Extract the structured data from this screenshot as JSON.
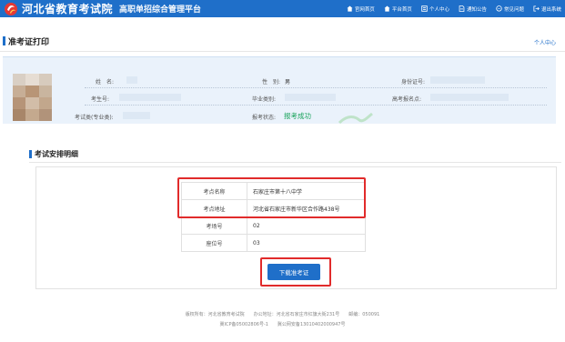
{
  "header": {
    "site_name": "河北省教育考试院",
    "platform_name": "高职单招综合管理平台",
    "nav": [
      {
        "label": "官网首页",
        "icon": "home-icon"
      },
      {
        "label": "平台首页",
        "icon": "home-icon"
      },
      {
        "label": "个人中心",
        "icon": "profile-icon"
      },
      {
        "label": "通知公告",
        "icon": "document-icon"
      },
      {
        "label": "常见问题",
        "icon": "chat-icon"
      },
      {
        "label": "退出系统",
        "icon": "logout-icon"
      }
    ]
  },
  "section_admit": {
    "title": "准考证打印",
    "personal_link": "个人中心",
    "fields": {
      "name_label": "姓　名:",
      "gender_label": "性　别:",
      "gender_value": "男",
      "id_label": "身份证号:",
      "exam_no_label": "考生号:",
      "grad_label": "毕业类别:",
      "high_school_label": "高考报名点:",
      "category_label": "考试类(专业类):",
      "status_label": "报考状态:",
      "status_value": "报考成功"
    }
  },
  "section_schedule": {
    "title": "考试安排明细",
    "rows": [
      {
        "label": "考点名称",
        "value": "石家庄市第十八中学"
      },
      {
        "label": "考点地址",
        "value": "河北省石家庄市新华区合作路438号"
      },
      {
        "label": "考场号",
        "value": "02"
      },
      {
        "label": "座位号",
        "value": "03"
      }
    ],
    "download_button": "下载准考证"
  },
  "footer": {
    "line1": "版权所有：河北省教育考试院　　办公地址：河北省石家庄市红旗大街231号　　邮编：050091",
    "line2": "冀ICP备05002806号-1　　冀公网安备13010402000947号"
  },
  "colors": {
    "brand_blue": "#1f6fc9",
    "highlight_red": "#e12b2b",
    "status_green": "#1aa35c"
  }
}
